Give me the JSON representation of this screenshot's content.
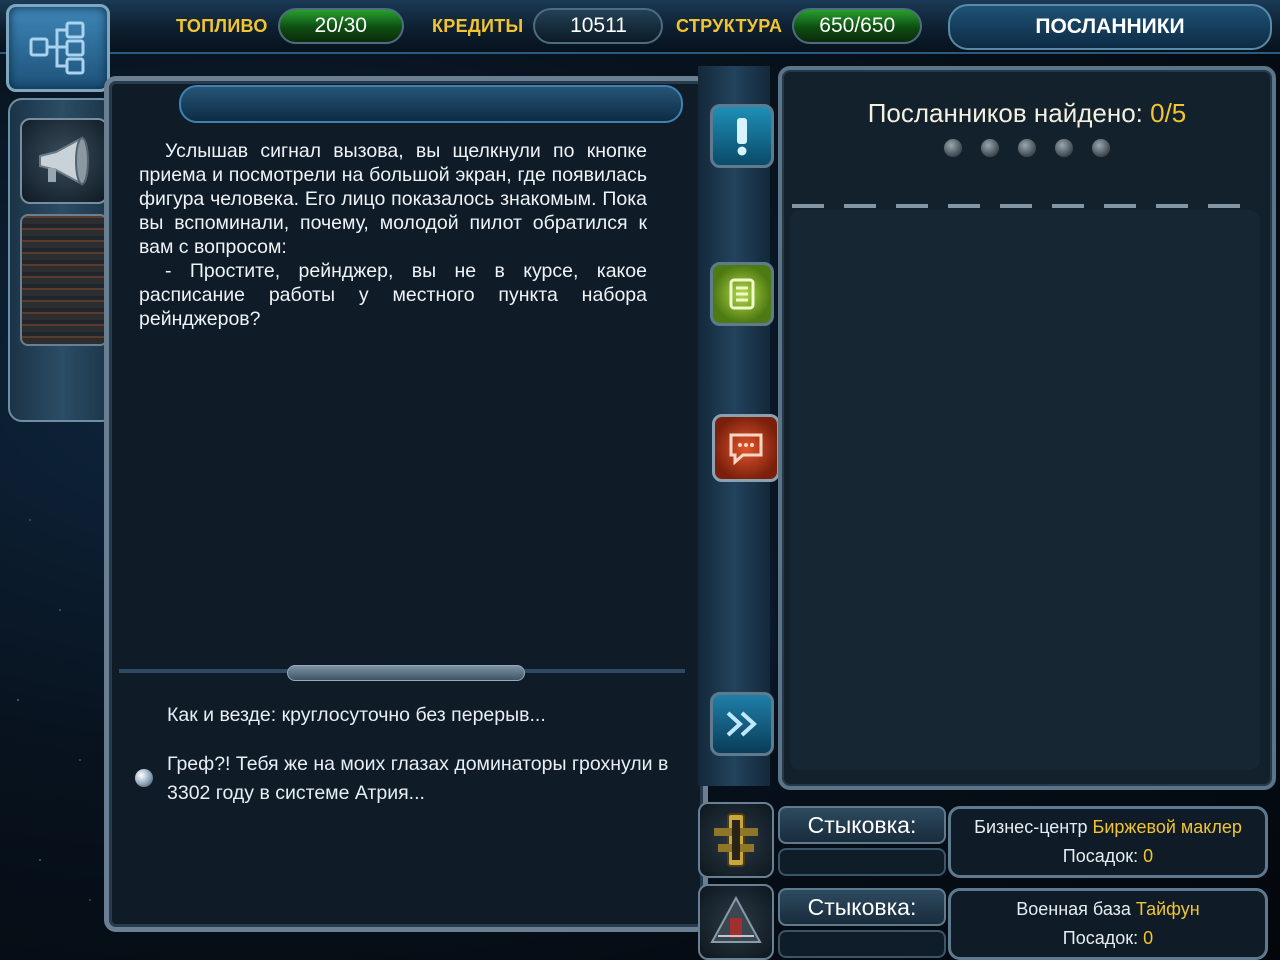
{
  "topbar": {
    "fuel_label": "ТОПЛИВО",
    "fuel_value": "20/30",
    "credits_label": "КРЕДИТЫ",
    "credits_value": "10511",
    "structure_label": "СТРУКТУРА",
    "structure_value": "650/650",
    "active_tab": "ПОСЛАННИКИ"
  },
  "dialog": {
    "story_paragraphs": [
      "Услышав сигнал вызова, вы щелкнули по кнопке приема и посмотрели на большой экран, где появилась фигура человека. Его лицо показалось знакомым. Пока вы вспоминали, почему, молодой пилот обратился к вам с вопросом:",
      "- Простите, рейнджер, вы не в курсе, какое расписание работы у местного пункта набора рейнджеров?"
    ],
    "answers": [
      "Как и везде: круглосуточно без перерыв...",
      "Греф?! Тебя же на моих глазах доминаторы грохнули в 3302 году в системе Атрия..."
    ]
  },
  "envoys": {
    "found_label": "Посланников найдено: ",
    "found_value": "0/5",
    "total_slots": 5
  },
  "docking": [
    {
      "label": "Стыковка:",
      "place_type": "Бизнес-центр",
      "place_name": "Биржевой маклер",
      "landings_label": "Посадок:",
      "landings_value": "0"
    },
    {
      "label": "Стыковка:",
      "place_type": "Военная база",
      "place_name": "Тайфун",
      "landings_label": "Посадок:",
      "landings_value": "0"
    }
  ],
  "colors": {
    "accent_yellow": "#f2c430",
    "pill_green": "#27a02d",
    "panel_bg": "#0f1c27"
  },
  "icons": {
    "logo": "network-diagram-icon",
    "speaker": "megaphone-icon",
    "side_buttons": [
      "exclamation-icon",
      "document-icon",
      "chat-bubble-icon",
      "fast-forward-icon"
    ]
  }
}
